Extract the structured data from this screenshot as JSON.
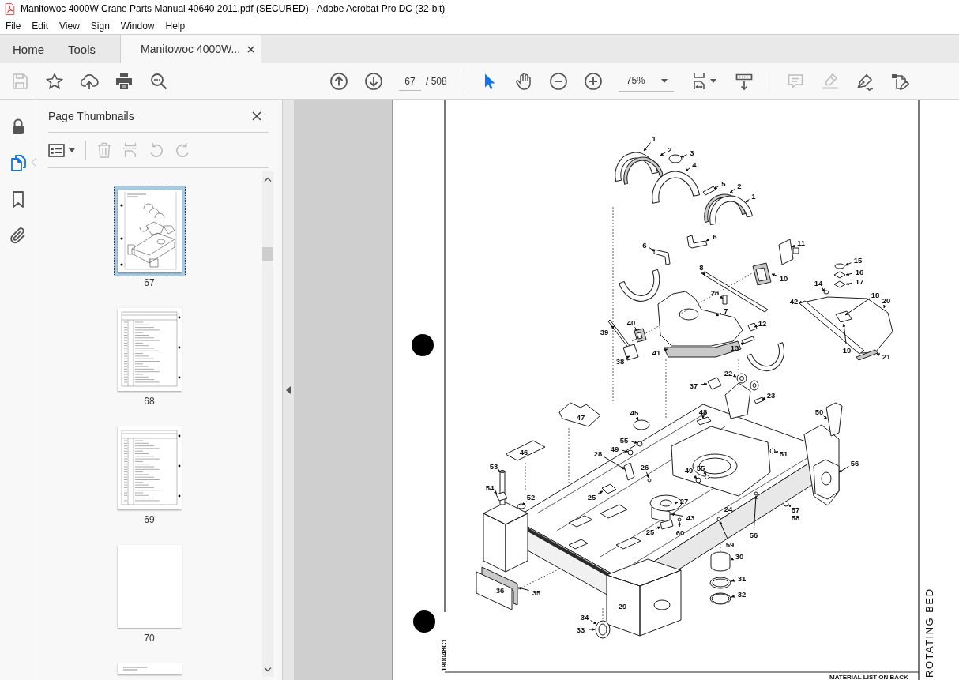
{
  "window": {
    "title": "Manitowoc 4000W Crane Parts Manual 40640 2011.pdf (SECURED) - Adobe Acrobat Pro DC (32-bit)"
  },
  "menu": [
    "File",
    "Edit",
    "View",
    "Sign",
    "Window",
    "Help"
  ],
  "tabs": [
    {
      "label": "Home",
      "kind": "nav",
      "selected": false
    },
    {
      "label": "Tools",
      "kind": "nav",
      "selected": false
    },
    {
      "label": "Manitowoc 4000W...",
      "kind": "document",
      "selected": true
    }
  ],
  "toolbar": {
    "save": {
      "disabled": true
    },
    "page_field": {
      "value": "67"
    },
    "page_total": "/ 508",
    "tools": [
      {
        "selected": true
      },
      {
        "selected": false
      }
    ],
    "zoom": {
      "value": "75%"
    },
    "comment": {
      "disabled": true
    },
    "highlight": {
      "disabled": true
    }
  },
  "nav_rail": [
    {
      "selected": false
    },
    {
      "selected": true
    },
    {
      "selected": false
    },
    {
      "selected": false
    }
  ],
  "thumbnails_panel": {
    "title": "Page Thumbnails",
    "tools": [
      {
        "disabled": false
      },
      {
        "disabled": true
      },
      {
        "disabled": true
      },
      {
        "disabled": true
      },
      {
        "disabled": true
      }
    ],
    "pages": [
      {
        "label": "67",
        "kind": "diagram",
        "selected": true
      },
      {
        "label": "68",
        "kind": "table",
        "selected": false
      },
      {
        "label": "69",
        "kind": "table",
        "selected": false
      },
      {
        "label": "70",
        "kind": "blank",
        "selected": false
      },
      {
        "kind": "text",
        "selected": false
      }
    ]
  },
  "document": {
    "callouts": [
      "1",
      "2",
      "3",
      "4",
      "5",
      "2",
      "1",
      "6",
      "6",
      "11",
      "15",
      "8",
      "16",
      "10",
      "14",
      "17",
      "26",
      "18",
      "42",
      "20",
      "7",
      "40",
      "12",
      "39",
      "41",
      "13",
      "19",
      "21",
      "38",
      "22",
      "37",
      "23",
      "45",
      "48",
      "50",
      "47",
      "55",
      "46",
      "28",
      "49",
      "51",
      "53",
      "26",
      "49",
      "55",
      "56",
      "54",
      "52",
      "25",
      "27",
      "24",
      "57",
      "43",
      "58",
      "25",
      "60",
      "56",
      "59",
      "30",
      "31",
      "36",
      "35",
      "32",
      "29",
      "34",
      "33"
    ],
    "drawing_number": "190048C1",
    "side_title": "ROTATING BED",
    "footer": "MATERIAL LIST ON BACK"
  }
}
